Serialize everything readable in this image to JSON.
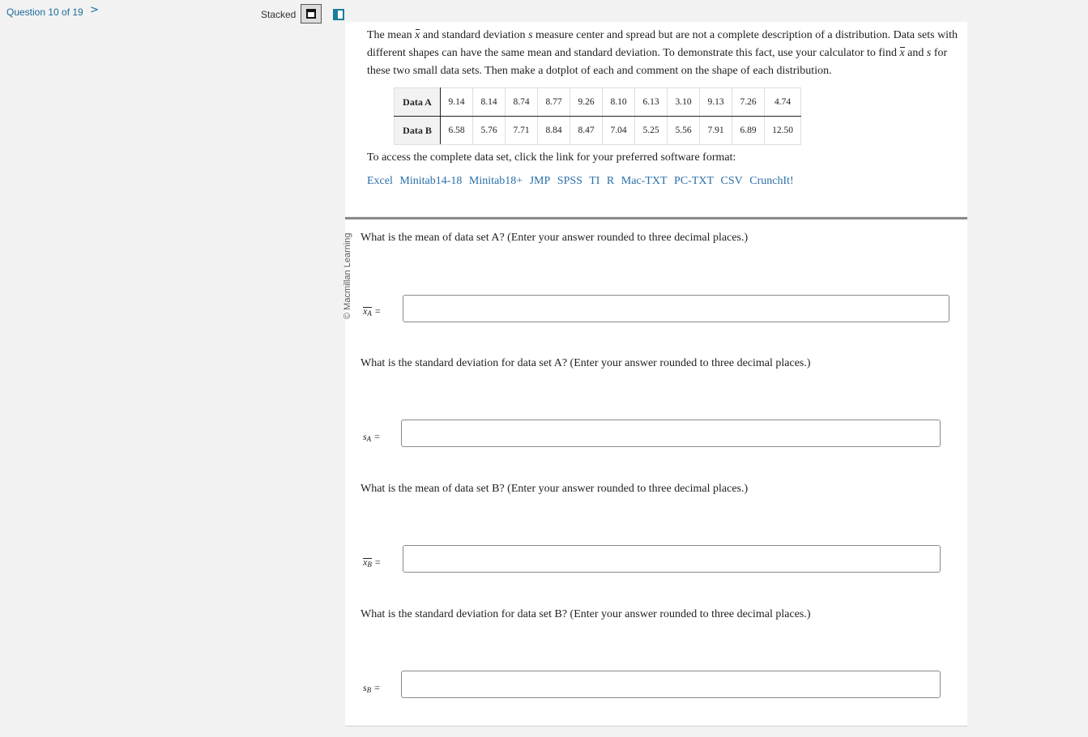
{
  "nav": {
    "question_label": "Question 10 of 19",
    "next_glyph": ">",
    "view_label": "Stacked"
  },
  "intro": {
    "part1": "The mean ",
    "part2": " and standard deviation ",
    "s": "s",
    "part3": " measure center and spread but are not a complete description of a distribution. Data sets with different shapes can have the same mean and standard deviation. To demonstrate this fact, use your calculator to find ",
    "part4": " and ",
    "part5": " for these two small data sets. Then make a dotplot of each and comment on the shape of each distribution.",
    "xbar": "x"
  },
  "table": {
    "row_a_label": "Data A",
    "row_a": [
      "9.14",
      "8.14",
      "8.74",
      "8.77",
      "9.26",
      "8.10",
      "6.13",
      "3.10",
      "9.13",
      "7.26",
      "4.74"
    ],
    "row_b_label": "Data B",
    "row_b": [
      "6.58",
      "5.76",
      "7.71",
      "8.84",
      "8.47",
      "7.04",
      "5.25",
      "5.56",
      "7.91",
      "6.89",
      "12.50"
    ]
  },
  "access_text": "To access the complete data set, click the link for your preferred software format:",
  "links": [
    "Excel",
    "Minitab14-18",
    "Minitab18+",
    "JMP",
    "SPSS",
    "TI",
    "R",
    "Mac-TXT",
    "PC-TXT",
    "CSV",
    "CrunchIt!"
  ],
  "copyright": "© Macmillan Learning",
  "questions": [
    {
      "text": "What is the mean of data set A? (Enter your answer rounded to three decimal places.)",
      "var": "x",
      "sub": "A",
      "value": "",
      "placeholder": ""
    },
    {
      "text": "What is the standard deviation for data set A? (Enter your answer rounded to three decimal places.)",
      "var": "s",
      "sub": "A",
      "value": "",
      "placeholder": ""
    },
    {
      "text": "What is the mean of data set B? (Enter your answer rounded to three decimal places.)",
      "var": "x",
      "sub": "B",
      "value": "",
      "placeholder": ""
    },
    {
      "text": "What is the standard deviation for data set B? (Enter your answer rounded to three decimal places.)",
      "var": "s",
      "sub": "B",
      "value": "",
      "placeholder": ""
    }
  ],
  "eq": "="
}
